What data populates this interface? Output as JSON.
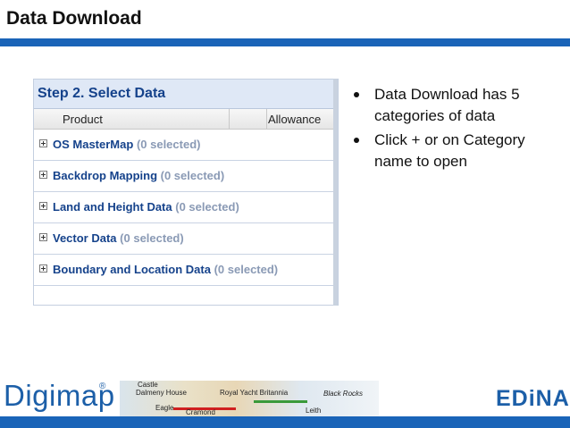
{
  "slide": {
    "title": "Data Download",
    "bullets": [
      "Data Download has 5 categories of data",
      "Click + or on Category name to open"
    ]
  },
  "panel": {
    "title": "Step 2. Select Data",
    "columns": {
      "product": "Product",
      "allowance": "Allowance"
    },
    "rows": [
      {
        "label": "OS MasterMap",
        "selected": "(0 selected)"
      },
      {
        "label": "Backdrop Mapping",
        "selected": "(0 selected)"
      },
      {
        "label": "Land and Height Data",
        "selected": "(0 selected)"
      },
      {
        "label": "Vector Data",
        "selected": "(0 selected)"
      },
      {
        "label": "Boundary and Location Data",
        "selected": "(0 selected)"
      }
    ]
  },
  "footer": {
    "digimap": "Digimap",
    "registered": "®",
    "edina": "EDiNA",
    "map_labels": [
      "Castle",
      "Dalmeny House",
      "Royal Yacht Britannia",
      "Black Rocks",
      "Eagle",
      "Cramond",
      "Leith"
    ]
  },
  "colors": {
    "accent": "#1a64b8",
    "panel_title": "#15428b"
  }
}
